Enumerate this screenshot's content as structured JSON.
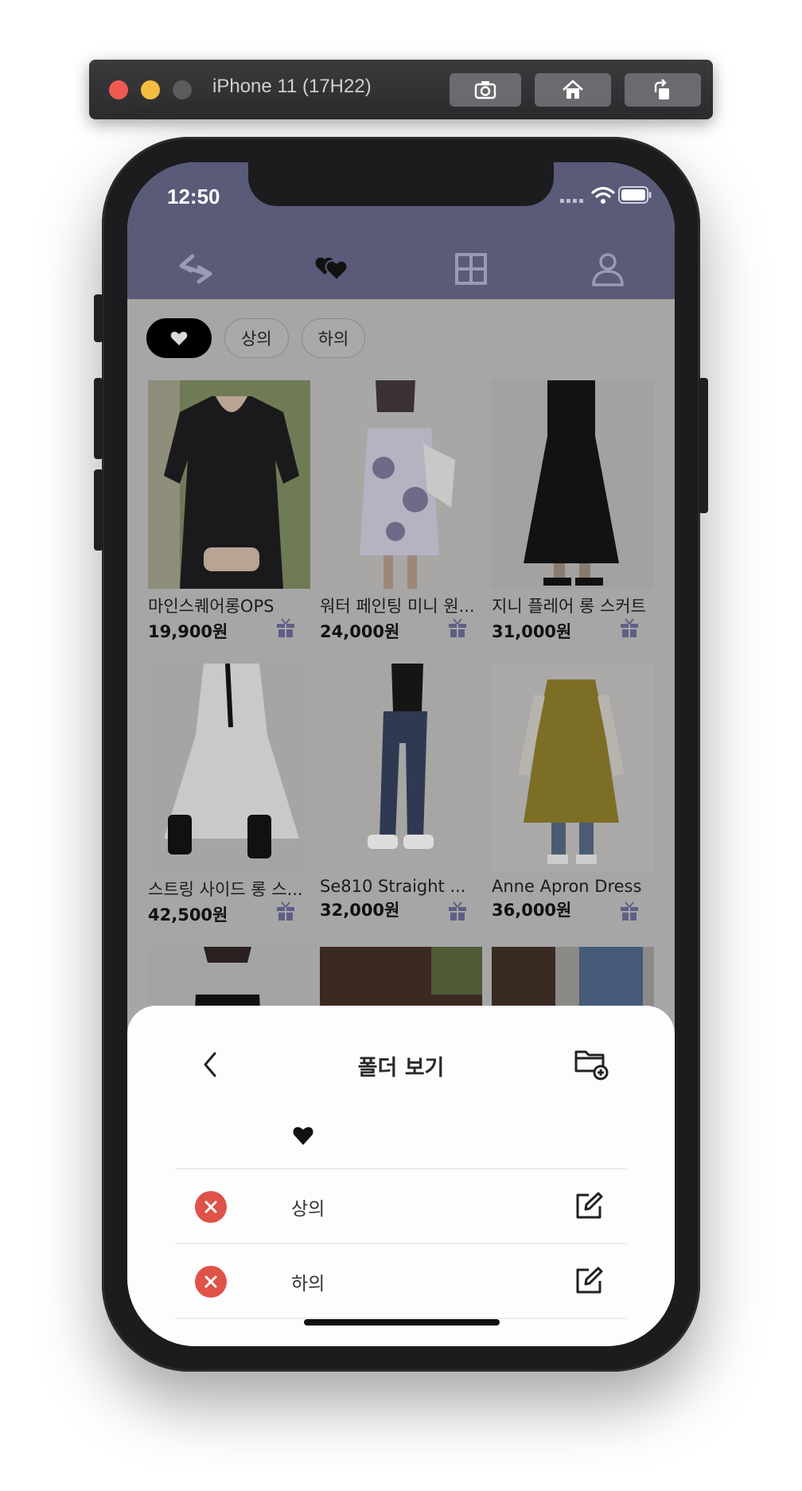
{
  "simulator": {
    "title": "iPhone 11 (17H22)",
    "buttons": [
      "screenshot",
      "home",
      "rotate"
    ]
  },
  "status_bar": {
    "time": "12:50"
  },
  "nav": {
    "tabs": [
      "swap-icon",
      "hearts-icon",
      "grid-icon",
      "profile-icon"
    ],
    "active": "hearts-icon"
  },
  "filters": {
    "chips": [
      "상의",
      "하의"
    ],
    "active_chip_icon": "heart-icon"
  },
  "products": [
    {
      "name": "마인스퀘어롱OPS",
      "price": "19,900원"
    },
    {
      "name": "워터 페인팅 미니 원...",
      "price": "24,000원"
    },
    {
      "name": "지니 플레어 롱 스커트",
      "price": "31,000원"
    },
    {
      "name": "스트링 사이드 롱 스...",
      "price": "42,500원"
    },
    {
      "name": "Se810 Straight ...",
      "price": "32,000원"
    },
    {
      "name": "Anne Apron Dress",
      "price": "36,000원"
    }
  ],
  "sheet": {
    "title": "폴더 보기",
    "folders": [
      {
        "label": "상의"
      },
      {
        "label": "하의"
      }
    ]
  },
  "colors": {
    "header": "#5a5a79",
    "delete": "#df5248",
    "accent": "#5f5f85"
  }
}
